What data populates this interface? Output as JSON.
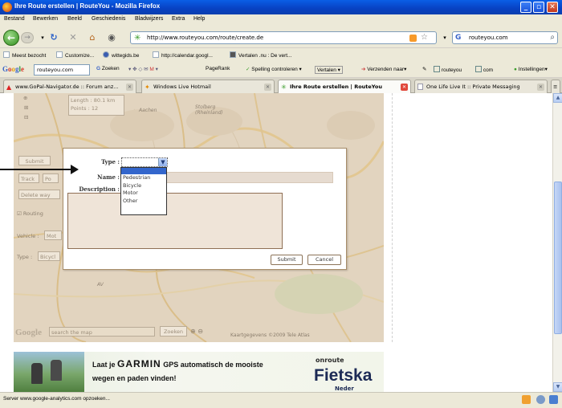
{
  "window": {
    "title": "Ihre Route erstellen | RouteYou - Mozilla Firefox"
  },
  "menu": [
    "Bestand",
    "Bewerken",
    "Beeld",
    "Geschiedenis",
    "Bladwijzers",
    "Extra",
    "Help"
  ],
  "nav": {
    "url": "http://www.routeyou.com/route/create.de",
    "search_value": "routeyou.com"
  },
  "bookmarks": [
    "Meest bezocht",
    "Customize...",
    "wittegids.be",
    "http://calendar.googl...",
    "Vertalen .nu : De vert..."
  ],
  "google_toolbar": {
    "logo": "Google",
    "search_value": "routeyou.com",
    "items": [
      "Zoeken",
      "PageRank",
      "Spelling controleren",
      "Vertalen",
      "Verzenden naar",
      "routeyou",
      "com",
      "Instellingen"
    ]
  },
  "tabs": [
    {
      "label": "www.GoPal-Navigator.de :: Forum anz...",
      "active": false
    },
    {
      "label": "Windows Live Hotmail",
      "active": false
    },
    {
      "label": "Ihre Route erstellen | RouteYou",
      "active": true
    },
    {
      "label": "One Life Live It :: Private Messaging",
      "active": false
    }
  ],
  "map": {
    "info_length": "Length : 80.1 km",
    "info_points": "Points : 12",
    "city_aachen": "Aachen",
    "city_stolberg": "Stolberg (Rheinland)",
    "btn_submit": "Submit",
    "btn_track": "Track",
    "btn_points": "Po",
    "btn_delete": "Delete way",
    "routing_label": "Routing",
    "vehicle_label": "Vehicle :",
    "vehicle_value": "Mot",
    "type_label": "Type :",
    "type_value": "Bicycl",
    "search_placeholder": "search the map",
    "zoom_label": "Zoeken",
    "copyright": "Kaartgegevens ©2009 Tele Atlas",
    "google_logo": "Google"
  },
  "dialog": {
    "type_label": "Type :",
    "name_label": "Name :",
    "description_label": "Description :",
    "type_options": [
      "",
      "Pedestrian",
      "Bicycle",
      "Motor",
      "Other"
    ],
    "submit_label": "Submit",
    "cancel_label": "Cancel"
  },
  "banner": {
    "text_prefix": "Laat je",
    "brand": "GARMIN",
    "text_suffix": "GPS automatisch de mooiste",
    "text_line2": "wegen en paden vinden!",
    "onroute": "onroute",
    "fiets": "Fietska",
    "fiets_sub": "Neder"
  },
  "status": {
    "text": "Server www.google-analytics.com opzoeken..."
  },
  "colors": {
    "titlebar": "#0841c2",
    "selected_option": "#3366cc",
    "dialog_border": "#a78d6a"
  }
}
